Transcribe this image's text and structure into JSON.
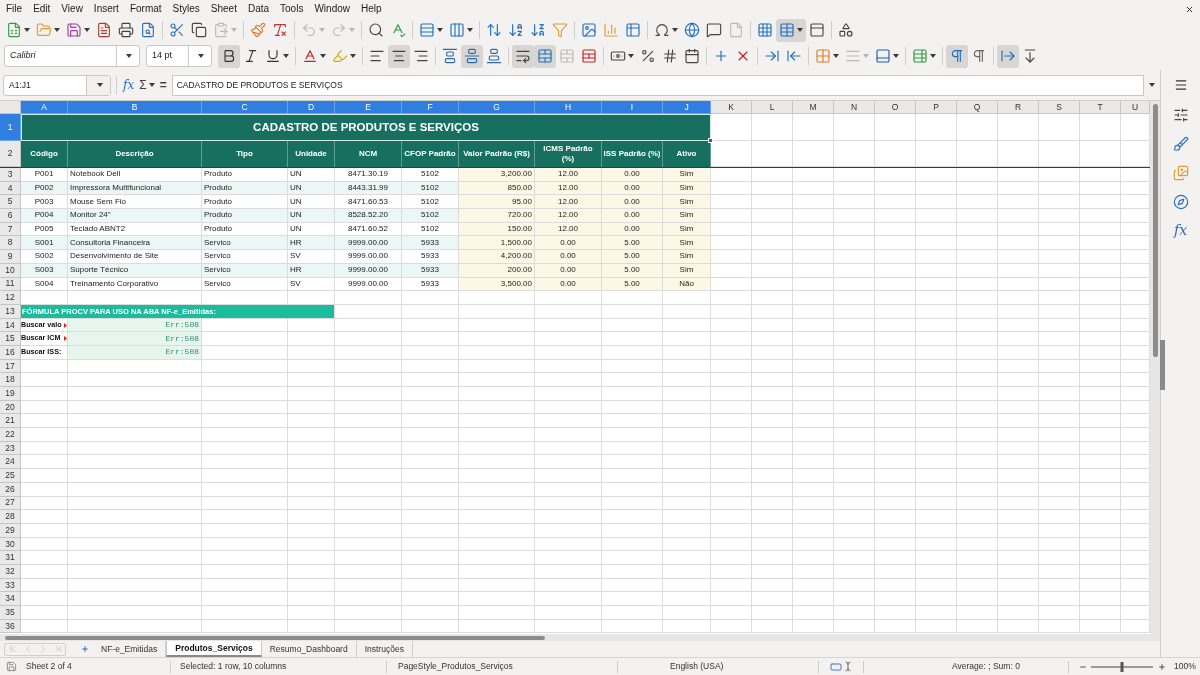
{
  "menu_bar": {
    "items": [
      "File",
      "Edit",
      "View",
      "Insert",
      "Format",
      "Styles",
      "Sheet",
      "Data",
      "Tools",
      "Window",
      "Help"
    ]
  },
  "standard_toolbar": [
    {
      "pressed": false,
      "disabled": false
    },
    {
      "pressed": false,
      "disabled": false
    },
    {
      "pressed": false,
      "disabled": false
    },
    {
      "pressed": false,
      "disabled": false
    },
    {
      "pressed": false,
      "disabled": false
    },
    {
      "pressed": false,
      "disabled": false
    },
    {
      "pressed": false,
      "disabled": false
    },
    {
      "pressed": false,
      "disabled": false
    },
    {
      "pressed": false,
      "disabled": true
    },
    {
      "pressed": false,
      "disabled": false
    },
    {
      "pressed": false,
      "disabled": false
    },
    {
      "pressed": false,
      "disabled": true
    },
    {
      "pressed": false,
      "disabled": true
    },
    {
      "pressed": false,
      "disabled": false
    },
    {
      "pressed": false,
      "disabled": false
    },
    {
      "pressed": false,
      "disabled": false
    },
    {
      "pressed": false,
      "disabled": false
    },
    {
      "pressed": false,
      "disabled": false
    },
    {
      "pressed": false,
      "disabled": false
    },
    {
      "pressed": false,
      "disabled": false
    },
    {
      "pressed": false,
      "disabled": false
    },
    {
      "pressed": false,
      "disabled": false
    },
    {
      "pressed": false,
      "disabled": false
    },
    {
      "pressed": false,
      "disabled": false
    },
    {
      "pressed": false,
      "disabled": false
    },
    {
      "pressed": false,
      "disabled": false
    },
    {
      "pressed": false,
      "disabled": false
    },
    {
      "pressed": false,
      "disabled": true
    },
    {
      "pressed": false,
      "disabled": false
    },
    {
      "pressed": true,
      "disabled": false
    },
    {
      "pressed": false,
      "disabled": false
    },
    {
      "pressed": false,
      "disabled": false
    }
  ],
  "formatting_toolbar": {
    "font_name": "Calibri",
    "font_size": "14 pt",
    "buttons": [
      {
        "pressed": true,
        "disabled": false
      },
      {
        "pressed": false,
        "disabled": false
      },
      {
        "pressed": false,
        "disabled": false
      },
      {
        "pressed": false,
        "disabled": false
      },
      {
        "pressed": false,
        "disabled": false
      },
      {
        "pressed": false,
        "disabled": false
      },
      {
        "pressed": true,
        "disabled": false
      },
      {
        "pressed": false,
        "disabled": false
      },
      {
        "pressed": false,
        "disabled": false
      },
      {
        "pressed": true,
        "disabled": false
      },
      {
        "pressed": false,
        "disabled": false
      },
      {
        "pressed": true,
        "disabled": false
      },
      {
        "pressed": true,
        "disabled": false
      },
      {
        "pressed": false,
        "disabled": true
      },
      {
        "pressed": false,
        "disabled": false
      },
      {
        "pressed": false,
        "disabled": false
      },
      {
        "pressed": false,
        "disabled": false
      },
      {
        "pressed": false,
        "disabled": false
      },
      {
        "pressed": false,
        "disabled": false
      },
      {
        "pressed": false,
        "disabled": false
      },
      {
        "pressed": false,
        "disabled": false
      },
      {
        "pressed": false,
        "disabled": false
      },
      {
        "pressed": false,
        "disabled": false
      },
      {
        "pressed": false,
        "disabled": false
      },
      {
        "pressed": false,
        "disabled": true
      },
      {
        "pressed": false,
        "disabled": false
      },
      {
        "pressed": false,
        "disabled": false
      },
      {
        "pressed": true,
        "disabled": false
      },
      {
        "pressed": false,
        "disabled": false
      },
      {
        "pressed": true,
        "disabled": false
      },
      {
        "pressed": false,
        "disabled": false
      }
    ]
  },
  "formula_bar": {
    "name_box": "A1:J1",
    "function_wizard": "fx",
    "sum": "Σ",
    "equals": "=",
    "formula": "CADASTRO DE PRODUTOS E SERVIÇOS"
  },
  "sheet": {
    "columns": [
      {
        "label": "A",
        "selected": true
      },
      {
        "label": "B",
        "selected": true
      },
      {
        "label": "C",
        "selected": true
      },
      {
        "label": "D",
        "selected": true
      },
      {
        "label": "E",
        "selected": true
      },
      {
        "label": "F",
        "selected": true
      },
      {
        "label": "G",
        "selected": true
      },
      {
        "label": "H",
        "selected": true
      },
      {
        "label": "I",
        "selected": true
      },
      {
        "label": "J",
        "selected": true
      },
      {
        "label": "K",
        "selected": false
      },
      {
        "label": "L",
        "selected": false
      },
      {
        "label": "M",
        "selected": false
      },
      {
        "label": "N",
        "selected": false
      },
      {
        "label": "O",
        "selected": false
      },
      {
        "label": "P",
        "selected": false
      },
      {
        "label": "Q",
        "selected": false
      },
      {
        "label": "R",
        "selected": false
      },
      {
        "label": "S",
        "selected": false
      },
      {
        "label": "T",
        "selected": false
      },
      {
        "label": "U",
        "selected": false
      }
    ],
    "rows": [
      {
        "label": "1",
        "selected": true
      },
      {
        "label": "2",
        "selected": false
      },
      {
        "label": "3",
        "selected": false
      },
      {
        "label": "4",
        "selected": false
      },
      {
        "label": "5",
        "selected": false
      },
      {
        "label": "6",
        "selected": false
      },
      {
        "label": "7",
        "selected": false
      },
      {
        "label": "8",
        "selected": false
      },
      {
        "label": "9",
        "selected": false
      },
      {
        "label": "10",
        "selected": false
      },
      {
        "label": "11",
        "selected": false
      },
      {
        "label": "12",
        "selected": false
      },
      {
        "label": "13",
        "selected": false
      },
      {
        "label": "14",
        "selected": false
      },
      {
        "label": "15",
        "selected": false
      },
      {
        "label": "16",
        "selected": false
      },
      {
        "label": "17",
        "selected": false
      },
      {
        "label": "18",
        "selected": false
      },
      {
        "label": "19",
        "selected": false
      },
      {
        "label": "20",
        "selected": false
      },
      {
        "label": "21",
        "selected": false
      },
      {
        "label": "22",
        "selected": false
      },
      {
        "label": "23",
        "selected": false
      },
      {
        "label": "24",
        "selected": false
      },
      {
        "label": "25",
        "selected": false
      },
      {
        "label": "26",
        "selected": false
      },
      {
        "label": "27",
        "selected": false
      },
      {
        "label": "28",
        "selected": false
      },
      {
        "label": "29",
        "selected": false
      },
      {
        "label": "30",
        "selected": false
      },
      {
        "label": "31",
        "selected": false
      },
      {
        "label": "32",
        "selected": false
      },
      {
        "label": "33",
        "selected": false
      },
      {
        "label": "34",
        "selected": false
      },
      {
        "label": "35",
        "selected": false
      },
      {
        "label": "36",
        "selected": false
      }
    ],
    "title": "CADASTRO DE PRODUTOS E SERVIÇOS",
    "headers": [
      "Código",
      "Descrição",
      "Tipo",
      "Unidade",
      "NCM",
      "CFOP Padrão",
      "Valor Padrão (R$)",
      "ICMS Padrão (%)",
      "ISS Padrão (%)",
      "Ativo"
    ],
    "data": [
      [
        "P001",
        "Notebook Dell",
        "Produto",
        "UN",
        "8471.30.19",
        "5102",
        "3,200.00",
        "12.00",
        "0.00",
        "Sim"
      ],
      [
        "P002",
        "Impressora Multifuncional",
        "Produto",
        "UN",
        "8443.31.99",
        "5102",
        "850.00",
        "12.00",
        "0.00",
        "Sim"
      ],
      [
        "P003",
        "Mouse Sem Fio",
        "Produto",
        "UN",
        "8471.60.53",
        "5102",
        "95.00",
        "12.00",
        "0.00",
        "Sim"
      ],
      [
        "P004",
        "Monitor 24\"",
        "Produto",
        "UN",
        "8528.52.20",
        "5102",
        "720.00",
        "12.00",
        "0.00",
        "Sim"
      ],
      [
        "P005",
        "Teclado ABNT2",
        "Produto",
        "UN",
        "8471.60.52",
        "5102",
        "150.00",
        "12.00",
        "0.00",
        "Sim"
      ],
      [
        "S001",
        "Consultoria Financeira",
        "Servico",
        "HR",
        "9999.00.00",
        "5933",
        "1,500.00",
        "0.00",
        "5.00",
        "Sim"
      ],
      [
        "S002",
        "Desenvolvimento de Site",
        "Servico",
        "SV",
        "9999.00.00",
        "5933",
        "4,200.00",
        "0.00",
        "5.00",
        "Sim"
      ],
      [
        "S003",
        "Suporte Técnico",
        "Servico",
        "HR",
        "9999.00.00",
        "5933",
        "200.00",
        "0.00",
        "5.00",
        "Sim"
      ],
      [
        "S004",
        "Treinamento Corporativo",
        "Servico",
        "SV",
        "9999.00.00",
        "5933",
        "3,500.00",
        "0.00",
        "5.00",
        "Não"
      ]
    ],
    "lookup": {
      "title": "FÓRMULA PROCV PARA USO NA ABA NF-e_Emitidas:",
      "rows": [
        {
          "label": "Buscar valo",
          "value": "Err:508",
          "clipped": true
        },
        {
          "label": "Buscar ICM",
          "value": "Err:508",
          "clipped": true
        },
        {
          "label": "Buscar ISS:",
          "value": "Err:508",
          "clipped": false
        }
      ]
    }
  },
  "sidebar": {
    "functions": "fx"
  },
  "tab_navigation": [
    {
      "disabled": true
    },
    {
      "disabled": true
    },
    {
      "disabled": true
    },
    {
      "disabled": true
    }
  ],
  "sheet_tabs": [
    {
      "label": "NF-e_Emitidas",
      "selected": false
    },
    {
      "label": "Produtos_Serviços",
      "selected": true
    },
    {
      "label": "Resumo_Dashboard",
      "selected": false
    },
    {
      "label": "Instruções",
      "selected": false
    }
  ],
  "status_bar": {
    "sheet": "Sheet 2 of 4",
    "selection": "Selected: 1 row, 10 columns",
    "page_style": "PageStyle_Produtos_Serviços",
    "language": "English (USA)",
    "summary": "Average: ; Sum: 0",
    "zoom": {
      "level": 0.5,
      "reading": "100%"
    }
  }
}
